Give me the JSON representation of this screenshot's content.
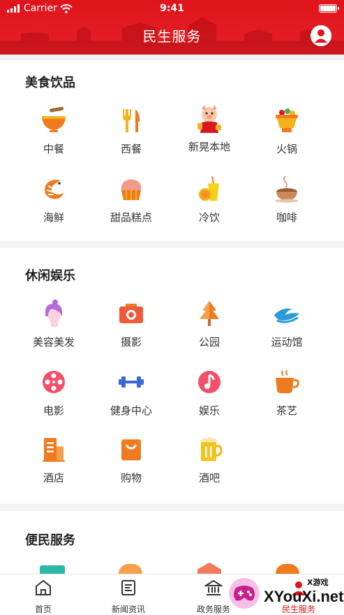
{
  "status_bar": {
    "carrier": "Carrier",
    "time": "9:41"
  },
  "header": {
    "title": "民生服务"
  },
  "sections": [
    {
      "title": "美食饮品",
      "items": [
        {
          "label": "中餐",
          "icon": "bowl-noodle-icon"
        },
        {
          "label": "西餐",
          "icon": "fork-knife-icon"
        },
        {
          "label": "新晃本地",
          "icon": "mascot-icon"
        },
        {
          "label": "火锅",
          "icon": "hotpot-icon"
        },
        {
          "label": "海鲜",
          "icon": "shrimp-icon"
        },
        {
          "label": "甜品糕点",
          "icon": "cake-icon"
        },
        {
          "label": "冷饮",
          "icon": "cold-drink-icon"
        },
        {
          "label": "咖啡",
          "icon": "coffee-icon"
        }
      ]
    },
    {
      "title": "休闲娱乐",
      "items": [
        {
          "label": "美容美发",
          "icon": "beauty-icon"
        },
        {
          "label": "摄影",
          "icon": "camera-icon"
        },
        {
          "label": "公园",
          "icon": "tree-icon"
        },
        {
          "label": "运动馆",
          "icon": "wave-icon"
        },
        {
          "label": "电影",
          "icon": "film-reel-icon"
        },
        {
          "label": "健身中心",
          "icon": "dumbbell-icon"
        },
        {
          "label": "娱乐",
          "icon": "music-note-icon"
        },
        {
          "label": "茶艺",
          "icon": "tea-cup-icon"
        },
        {
          "label": "酒店",
          "icon": "hotel-icon"
        },
        {
          "label": "购物",
          "icon": "shopping-bag-icon"
        },
        {
          "label": "酒吧",
          "icon": "beer-mug-icon"
        }
      ]
    },
    {
      "title": "便民服务"
    }
  ],
  "tabbar": [
    {
      "label": "首页",
      "icon": "home-icon"
    },
    {
      "label": "新闻资讯",
      "icon": "news-icon"
    },
    {
      "label": "政务服务",
      "icon": "government-icon"
    },
    {
      "label": "民生服务",
      "icon": "people-service-icon"
    }
  ],
  "watermark": {
    "brand": "XYouXi.net",
    "small": "X游戏"
  },
  "colors": {
    "accent": "#e0141b",
    "icon_orange": "#f07a1e",
    "icon_yellow": "#f5b21a"
  }
}
